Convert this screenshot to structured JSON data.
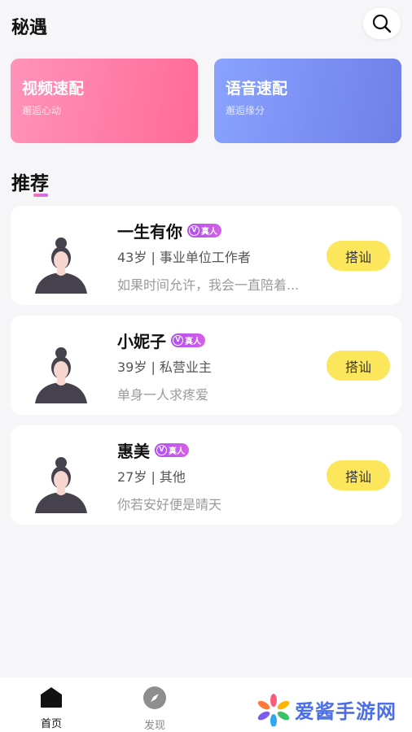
{
  "header": {
    "title": "秘遇",
    "search_icon": "search-icon"
  },
  "match_cards": [
    {
      "title": "视频速配",
      "subtitle": "邂逅心动",
      "color_from": "#ff93b9",
      "color_to": "#ff6a98"
    },
    {
      "title": "语音速配",
      "subtitle": "邂逅缘分",
      "color_from": "#8aa3ff",
      "color_to": "#6f7fe8"
    }
  ],
  "section": {
    "title": "推荐"
  },
  "badge_label": "真人",
  "users": [
    {
      "name": "一生有你",
      "info": "43岁 | 事业单位工作者",
      "signature": "如果时间允许，我会一直陪着...",
      "action": "搭讪"
    },
    {
      "name": "小妮子",
      "info": "39岁 | 私营业主",
      "signature": "单身一人求疼爱",
      "action": "搭讪"
    },
    {
      "name": "惠美",
      "info": "27岁 | 其他",
      "signature": "你若安好便是晴天",
      "action": "搭讪"
    }
  ],
  "tabs": [
    {
      "label": "首页",
      "icon": "home-icon",
      "active": true
    },
    {
      "label": "发现",
      "icon": "compass-icon",
      "active": false
    }
  ],
  "watermark": {
    "text": "爱酱手游网"
  },
  "colors": {
    "accent_yellow": "#fce65b",
    "badge_purple": "#b04ef2"
  }
}
